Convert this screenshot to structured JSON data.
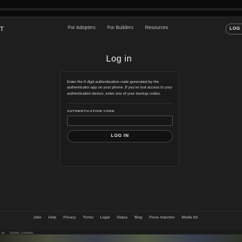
{
  "nav": {
    "logo_partial": "T",
    "links": [
      "For Adopters",
      "For Builders",
      "Resources"
    ],
    "login_label": "LOG IN"
  },
  "title": "Log in",
  "auth": {
    "description": "Enter the 6 digit authentication code generated by the authenticator app on your phone. If you've lost access to your authentication device, enter one of your backup codes.",
    "field_label": "AUTHENTICATION CODE",
    "code_value": "",
    "submit_label": "LOG IN"
  },
  "footer": {
    "links": [
      "Jobs",
      "Help",
      "Privacy",
      "Terms",
      "Legal",
      "Status",
      "Blog",
      "Press Inquiries",
      "Media Kit"
    ]
  },
  "taskbar": {
    "items": [
      "AV",
      "SCENE",
      "LOADING"
    ]
  }
}
